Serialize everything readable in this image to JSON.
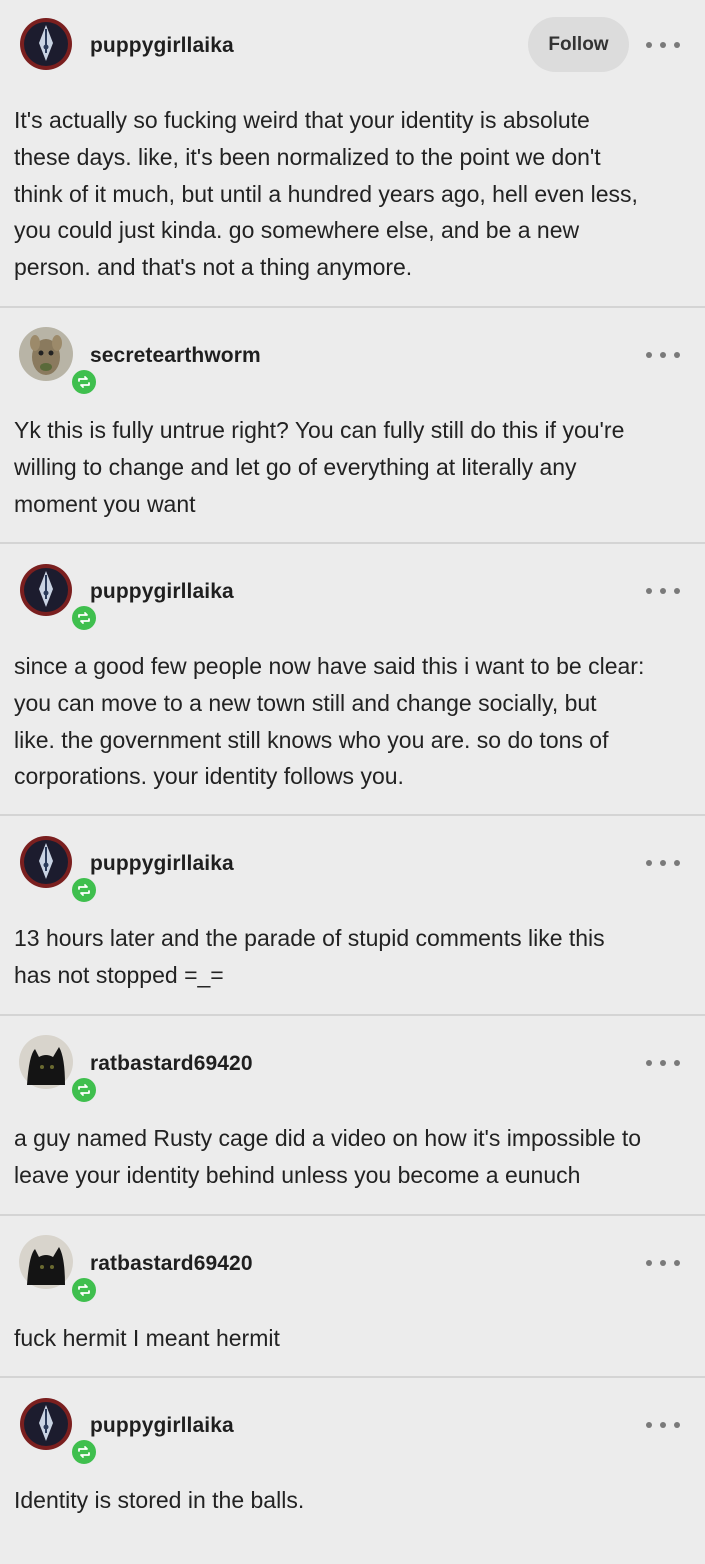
{
  "follow_label": "Follow",
  "colors": {
    "background": "#ececec",
    "divider": "#d4d4d4",
    "reblog_badge": "#3fbf4e",
    "follow_button": "#dcdcdc"
  },
  "posts": [
    {
      "username": "puppygirllaika",
      "avatar": "fountain-pen-nib-avatar",
      "reblog_badge": false,
      "show_follow": true,
      "text": "It's actually so fucking weird that your identity is absolute\nthese days. like, it's been normalized to the point we don't\nthink of it much, but until a hundred years ago, hell even less,\nyou could just kinda. go somewhere else, and be a new\nperson. and that's not a thing anymore."
    },
    {
      "username": "secretearthworm",
      "avatar": "creature-photo-avatar",
      "reblog_badge": true,
      "text": "Yk this is fully untrue right? You can fully still do this if you're\nwilling to change and let go of everything at literally any\nmoment you want"
    },
    {
      "username": "puppygirllaika",
      "avatar": "fountain-pen-nib-avatar",
      "reblog_badge": true,
      "text": "since a good few people now have said this i want to be clear:\nyou can move to a new town still and change socially, but\nlike. the government still knows who you are. so do tons of\ncorporations. your identity follows you."
    },
    {
      "username": "puppygirllaika",
      "avatar": "fountain-pen-nib-avatar",
      "reblog_badge": true,
      "text": "13 hours later and the parade of stupid comments like this\nhas not stopped =_="
    },
    {
      "username": "ratbastard69420",
      "avatar": "black-cat-avatar",
      "reblog_badge": true,
      "text": "a guy named Rusty cage did a video on how it's impossible to\nleave your identity behind unless you become a eunuch"
    },
    {
      "username": "ratbastard69420",
      "avatar": "black-cat-avatar",
      "reblog_badge": true,
      "text": "fuck hermit I meant hermit"
    },
    {
      "username": "puppygirllaika",
      "avatar": "fountain-pen-nib-avatar",
      "reblog_badge": true,
      "text": "Identity is stored in the balls."
    }
  ]
}
